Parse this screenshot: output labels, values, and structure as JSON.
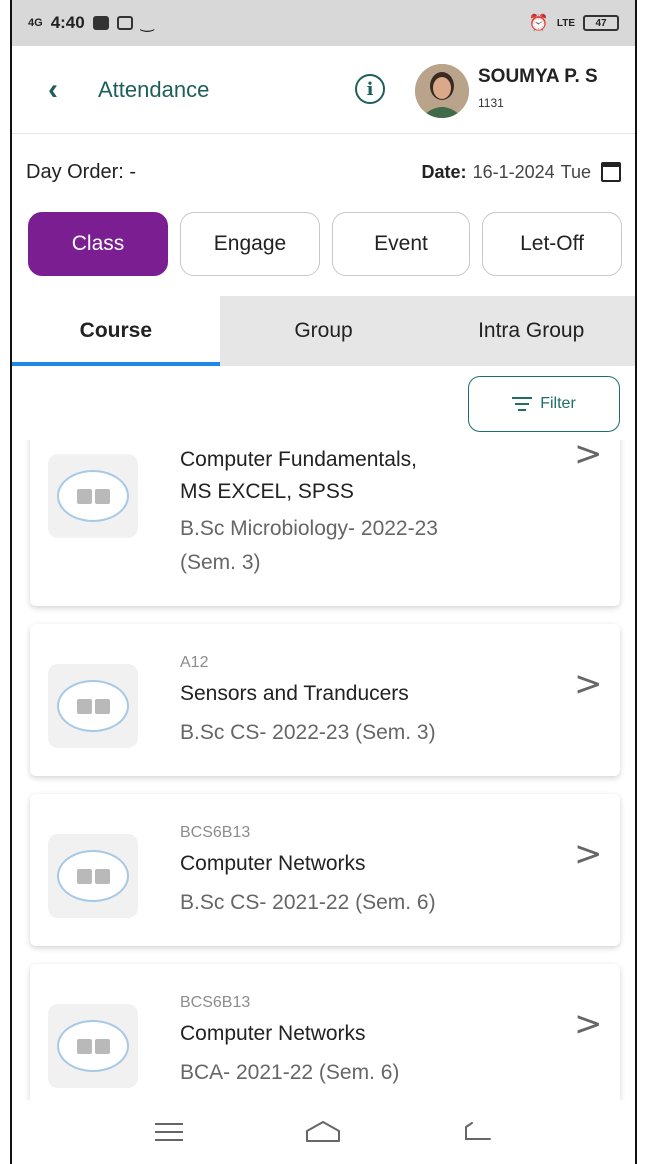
{
  "status_bar": {
    "network": "4G",
    "time": "4:40",
    "lte": "LTE",
    "battery": "47"
  },
  "header": {
    "title": "Attendance",
    "user_name": "SOUMYA P. S",
    "user_id": "1131"
  },
  "date_row": {
    "day_order": "Day Order: -",
    "date_label": "Date:",
    "date_value": "16-1-2024",
    "day": "Tue"
  },
  "segments": [
    {
      "label": "Class"
    },
    {
      "label": "Engage"
    },
    {
      "label": "Event"
    },
    {
      "label": "Let-Off"
    }
  ],
  "tabs": [
    {
      "label": "Course"
    },
    {
      "label": "Group"
    },
    {
      "label": "Intra Group"
    }
  ],
  "filter": {
    "label": "Filter"
  },
  "courses": [
    {
      "code": "",
      "title_line1": "Computer Fundamentals,",
      "title_line2": "MS EXCEL, SPSS",
      "sub_line1": "B.Sc Microbiology- 2022-23",
      "sub_line2": "(Sem. 3)"
    },
    {
      "code": "A12",
      "title_line1": "Sensors and Tranducers",
      "sub_line1": "B.Sc CS- 2022-23 (Sem. 3)"
    },
    {
      "code": "BCS6B13",
      "title_line1": "Computer Networks",
      "sub_line1": "B.Sc CS- 2021-22 (Sem. 6)"
    },
    {
      "code": "BCS6B13",
      "title_line1": "Computer Networks",
      "sub_line1": "BCA- 2021-22 (Sem. 6)"
    }
  ],
  "colors": {
    "accent": "#7b1e91",
    "header_text": "#1e5f5b",
    "tab_indicator": "#1e88e5"
  }
}
